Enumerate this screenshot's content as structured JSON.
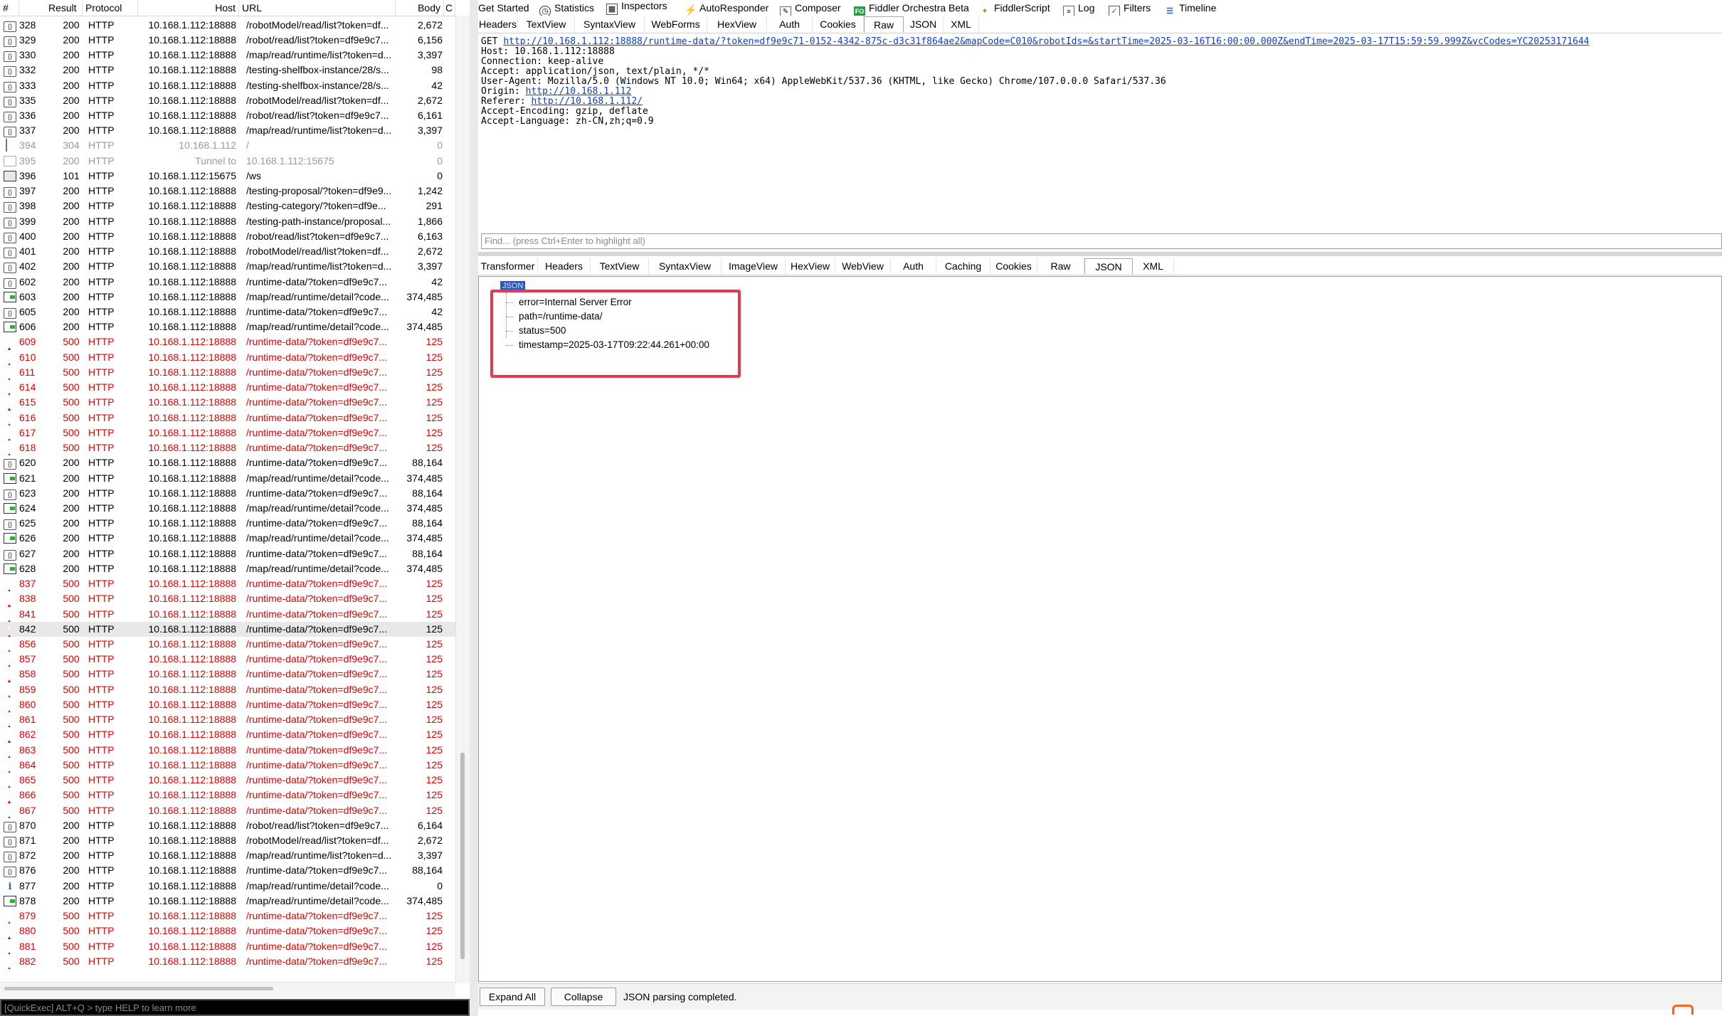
{
  "session_list": {
    "columns": [
      "#",
      "Result",
      "Protocol",
      "Host",
      "URL",
      "Body",
      "C"
    ],
    "rows": [
      {
        "icon": "doc",
        "num": "328",
        "result": "200",
        "protocol": "HTTP",
        "host": "10.168.1.112:18888",
        "url": "/robotModel/read/list?token=df...",
        "body": "2,672",
        "style": "normal"
      },
      {
        "icon": "doc",
        "num": "329",
        "result": "200",
        "protocol": "HTTP",
        "host": "10.168.1.112:18888",
        "url": "/robot/read/list?token=df9e9c7...",
        "body": "6,156",
        "style": "normal"
      },
      {
        "icon": "doc",
        "num": "330",
        "result": "200",
        "protocol": "HTTP",
        "host": "10.168.1.112:18888",
        "url": "/map/read/runtime/list?token=d...",
        "body": "3,397",
        "style": "normal"
      },
      {
        "icon": "doc",
        "num": "332",
        "result": "200",
        "protocol": "HTTP",
        "host": "10.168.1.112:18888",
        "url": "/testing-shelfbox-instance/28/s...",
        "body": "98",
        "style": "normal"
      },
      {
        "icon": "doc",
        "num": "333",
        "result": "200",
        "protocol": "HTTP",
        "host": "10.168.1.112:18888",
        "url": "/testing-shelfbox-instance/28/s...",
        "body": "42",
        "style": "normal"
      },
      {
        "icon": "doc",
        "num": "335",
        "result": "200",
        "protocol": "HTTP",
        "host": "10.168.1.112:18888",
        "url": "/robotModel/read/list?token=df...",
        "body": "2,672",
        "style": "normal"
      },
      {
        "icon": "doc",
        "num": "336",
        "result": "200",
        "protocol": "HTTP",
        "host": "10.168.1.112:18888",
        "url": "/robot/read/list?token=df9e9c7...",
        "body": "6,161",
        "style": "normal"
      },
      {
        "icon": "doc",
        "num": "337",
        "result": "200",
        "protocol": "HTTP",
        "host": "10.168.1.112:18888",
        "url": "/map/read/runtime/list?token=d...",
        "body": "3,397",
        "style": "normal"
      },
      {
        "icon": "diamond",
        "num": "394",
        "result": "304",
        "protocol": "HTTP",
        "host": "10.168.1.112",
        "url": "/",
        "body": "0",
        "style": "gray"
      },
      {
        "icon": "lock",
        "num": "395",
        "result": "200",
        "protocol": "HTTP",
        "host": "Tunnel to",
        "url": "10.168.1.112:15675",
        "body": "0",
        "style": "gray"
      },
      {
        "icon": "ws",
        "num": "396",
        "result": "101",
        "protocol": "HTTP",
        "host": "10.168.1.112:15675",
        "url": "/ws",
        "body": "0",
        "style": "normal"
      },
      {
        "icon": "doc",
        "num": "397",
        "result": "200",
        "protocol": "HTTP",
        "host": "10.168.1.112:18888",
        "url": "/testing-proposal/?token=df9e9...",
        "body": "1,242",
        "style": "normal"
      },
      {
        "icon": "doc",
        "num": "398",
        "result": "200",
        "protocol": "HTTP",
        "host": "10.168.1.112:18888",
        "url": "/testing-category/?token=df9e...",
        "body": "291",
        "style": "normal"
      },
      {
        "icon": "doc",
        "num": "399",
        "result": "200",
        "protocol": "HTTP",
        "host": "10.168.1.112:18888",
        "url": "/testing-path-instance/proposal...",
        "body": "1,866",
        "style": "normal"
      },
      {
        "icon": "doc",
        "num": "400",
        "result": "200",
        "protocol": "HTTP",
        "host": "10.168.1.112:18888",
        "url": "/robot/read/list?token=df9e9c7...",
        "body": "6,163",
        "style": "normal"
      },
      {
        "icon": "doc",
        "num": "401",
        "result": "200",
        "protocol": "HTTP",
        "host": "10.168.1.112:18888",
        "url": "/robotModel/read/list?token=df...",
        "body": "2,672",
        "style": "normal"
      },
      {
        "icon": "doc",
        "num": "402",
        "result": "200",
        "protocol": "HTTP",
        "host": "10.168.1.112:18888",
        "url": "/map/read/runtime/list?token=d...",
        "body": "3,397",
        "style": "normal"
      },
      {
        "icon": "doc",
        "num": "602",
        "result": "200",
        "protocol": "HTTP",
        "host": "10.168.1.112:18888",
        "url": "/runtime-data/?token=df9e9c7...",
        "body": "42",
        "style": "normal"
      },
      {
        "icon": "green",
        "num": "603",
        "result": "200",
        "protocol": "HTTP",
        "host": "10.168.1.112:18888",
        "url": "/map/read/runtime/detail?code...",
        "body": "374,485",
        "style": "normal"
      },
      {
        "icon": "doc",
        "num": "605",
        "result": "200",
        "protocol": "HTTP",
        "host": "10.168.1.112:18888",
        "url": "/runtime-data/?token=df9e9c7...",
        "body": "42",
        "style": "normal"
      },
      {
        "icon": "green",
        "num": "606",
        "result": "200",
        "protocol": "HTTP",
        "host": "10.168.1.112:18888",
        "url": "/map/read/runtime/detail?code...",
        "body": "374,485",
        "style": "normal"
      },
      {
        "icon": "warn",
        "num": "609",
        "result": "500",
        "protocol": "HTTP",
        "host": "10.168.1.112:18888",
        "url": "/runtime-data/?token=df9e9c7...",
        "body": "125",
        "style": "err"
      },
      {
        "icon": "warn",
        "num": "610",
        "result": "500",
        "protocol": "HTTP",
        "host": "10.168.1.112:18888",
        "url": "/runtime-data/?token=df9e9c7...",
        "body": "125",
        "style": "err"
      },
      {
        "icon": "warn",
        "num": "611",
        "result": "500",
        "protocol": "HTTP",
        "host": "10.168.1.112:18888",
        "url": "/runtime-data/?token=df9e9c7...",
        "body": "125",
        "style": "err"
      },
      {
        "icon": "warn",
        "num": "614",
        "result": "500",
        "protocol": "HTTP",
        "host": "10.168.1.112:18888",
        "url": "/runtime-data/?token=df9e9c7...",
        "body": "125",
        "style": "err"
      },
      {
        "icon": "warn",
        "num": "615",
        "result": "500",
        "protocol": "HTTP",
        "host": "10.168.1.112:18888",
        "url": "/runtime-data/?token=df9e9c7...",
        "body": "125",
        "style": "err"
      },
      {
        "icon": "warn",
        "num": "616",
        "result": "500",
        "protocol": "HTTP",
        "host": "10.168.1.112:18888",
        "url": "/runtime-data/?token=df9e9c7...",
        "body": "125",
        "style": "err"
      },
      {
        "icon": "warn",
        "num": "617",
        "result": "500",
        "protocol": "HTTP",
        "host": "10.168.1.112:18888",
        "url": "/runtime-data/?token=df9e9c7...",
        "body": "125",
        "style": "err"
      },
      {
        "icon": "warn",
        "num": "618",
        "result": "500",
        "protocol": "HTTP",
        "host": "10.168.1.112:18888",
        "url": "/runtime-data/?token=df9e9c7...",
        "body": "125",
        "style": "err"
      },
      {
        "icon": "doc",
        "num": "620",
        "result": "200",
        "protocol": "HTTP",
        "host": "10.168.1.112:18888",
        "url": "/runtime-data/?token=df9e9c7...",
        "body": "88,164",
        "style": "normal"
      },
      {
        "icon": "green",
        "num": "621",
        "result": "200",
        "protocol": "HTTP",
        "host": "10.168.1.112:18888",
        "url": "/map/read/runtime/detail?code...",
        "body": "374,485",
        "style": "normal"
      },
      {
        "icon": "doc",
        "num": "623",
        "result": "200",
        "protocol": "HTTP",
        "host": "10.168.1.112:18888",
        "url": "/runtime-data/?token=df9e9c7...",
        "body": "88,164",
        "style": "normal"
      },
      {
        "icon": "green",
        "num": "624",
        "result": "200",
        "protocol": "HTTP",
        "host": "10.168.1.112:18888",
        "url": "/map/read/runtime/detail?code...",
        "body": "374,485",
        "style": "normal"
      },
      {
        "icon": "doc",
        "num": "625",
        "result": "200",
        "protocol": "HTTP",
        "host": "10.168.1.112:18888",
        "url": "/runtime-data/?token=df9e9c7...",
        "body": "88,164",
        "style": "normal"
      },
      {
        "icon": "green",
        "num": "626",
        "result": "200",
        "protocol": "HTTP",
        "host": "10.168.1.112:18888",
        "url": "/map/read/runtime/detail?code...",
        "body": "374,485",
        "style": "normal"
      },
      {
        "icon": "doc",
        "num": "627",
        "result": "200",
        "protocol": "HTTP",
        "host": "10.168.1.112:18888",
        "url": "/runtime-data/?token=df9e9c7...",
        "body": "88,164",
        "style": "normal"
      },
      {
        "icon": "green",
        "num": "628",
        "result": "200",
        "protocol": "HTTP",
        "host": "10.168.1.112:18888",
        "url": "/map/read/runtime/detail?code...",
        "body": "374,485",
        "style": "normal"
      },
      {
        "icon": "warn",
        "num": "837",
        "result": "500",
        "protocol": "HTTP",
        "host": "10.168.1.112:18888",
        "url": "/runtime-data/?token=df9e9c7...",
        "body": "125",
        "style": "err"
      },
      {
        "icon": "warn",
        "num": "838",
        "result": "500",
        "protocol": "HTTP",
        "host": "10.168.1.112:18888",
        "url": "/runtime-data/?token=df9e9c7...",
        "body": "125",
        "style": "err"
      },
      {
        "icon": "warn",
        "num": "841",
        "result": "500",
        "protocol": "HTTP",
        "host": "10.168.1.112:18888",
        "url": "/runtime-data/?token=df9e9c7...",
        "body": "125",
        "style": "err"
      },
      {
        "icon": "warn",
        "num": "842",
        "result": "500",
        "protocol": "HTTP",
        "host": "10.168.1.112:18888",
        "url": "/runtime-data/?token=df9e9c7...",
        "body": "125",
        "style": "selected"
      },
      {
        "icon": "warn",
        "num": "856",
        "result": "500",
        "protocol": "HTTP",
        "host": "10.168.1.112:18888",
        "url": "/runtime-data/?token=df9e9c7...",
        "body": "125",
        "style": "err"
      },
      {
        "icon": "warn",
        "num": "857",
        "result": "500",
        "protocol": "HTTP",
        "host": "10.168.1.112:18888",
        "url": "/runtime-data/?token=df9e9c7...",
        "body": "125",
        "style": "err"
      },
      {
        "icon": "warn",
        "num": "858",
        "result": "500",
        "protocol": "HTTP",
        "host": "10.168.1.112:18888",
        "url": "/runtime-data/?token=df9e9c7...",
        "body": "125",
        "style": "err"
      },
      {
        "icon": "warn",
        "num": "859",
        "result": "500",
        "protocol": "HTTP",
        "host": "10.168.1.112:18888",
        "url": "/runtime-data/?token=df9e9c7...",
        "body": "125",
        "style": "err"
      },
      {
        "icon": "warn",
        "num": "860",
        "result": "500",
        "protocol": "HTTP",
        "host": "10.168.1.112:18888",
        "url": "/runtime-data/?token=df9e9c7...",
        "body": "125",
        "style": "err"
      },
      {
        "icon": "warn",
        "num": "861",
        "result": "500",
        "protocol": "HTTP",
        "host": "10.168.1.112:18888",
        "url": "/runtime-data/?token=df9e9c7...",
        "body": "125",
        "style": "err"
      },
      {
        "icon": "warn",
        "num": "862",
        "result": "500",
        "protocol": "HTTP",
        "host": "10.168.1.112:18888",
        "url": "/runtime-data/?token=df9e9c7...",
        "body": "125",
        "style": "err"
      },
      {
        "icon": "warn",
        "num": "863",
        "result": "500",
        "protocol": "HTTP",
        "host": "10.168.1.112:18888",
        "url": "/runtime-data/?token=df9e9c7...",
        "body": "125",
        "style": "err"
      },
      {
        "icon": "warn",
        "num": "864",
        "result": "500",
        "protocol": "HTTP",
        "host": "10.168.1.112:18888",
        "url": "/runtime-data/?token=df9e9c7...",
        "body": "125",
        "style": "err"
      },
      {
        "icon": "warn",
        "num": "865",
        "result": "500",
        "protocol": "HTTP",
        "host": "10.168.1.112:18888",
        "url": "/runtime-data/?token=df9e9c7...",
        "body": "125",
        "style": "err"
      },
      {
        "icon": "warn",
        "num": "866",
        "result": "500",
        "protocol": "HTTP",
        "host": "10.168.1.112:18888",
        "url": "/runtime-data/?token=df9e9c7...",
        "body": "125",
        "style": "err"
      },
      {
        "icon": "warn",
        "num": "867",
        "result": "500",
        "protocol": "HTTP",
        "host": "10.168.1.112:18888",
        "url": "/runtime-data/?token=df9e9c7...",
        "body": "125",
        "style": "err"
      },
      {
        "icon": "doc",
        "num": "870",
        "result": "200",
        "protocol": "HTTP",
        "host": "10.168.1.112:18888",
        "url": "/robot/read/list?token=df9e9c7...",
        "body": "6,164",
        "style": "normal"
      },
      {
        "icon": "doc",
        "num": "871",
        "result": "200",
        "protocol": "HTTP",
        "host": "10.168.1.112:18888",
        "url": "/robotModel/read/list?token=df...",
        "body": "2,672",
        "style": "normal"
      },
      {
        "icon": "doc",
        "num": "872",
        "result": "200",
        "protocol": "HTTP",
        "host": "10.168.1.112:18888",
        "url": "/map/read/runtime/list?token=d...",
        "body": "3,397",
        "style": "normal"
      },
      {
        "icon": "doc",
        "num": "876",
        "result": "200",
        "protocol": "HTTP",
        "host": "10.168.1.112:18888",
        "url": "/runtime-data/?token=df9e9c7...",
        "body": "88,164",
        "style": "normal"
      },
      {
        "icon": "info",
        "num": "877",
        "result": "200",
        "protocol": "HTTP",
        "host": "10.168.1.112:18888",
        "url": "/map/read/runtime/detail?code...",
        "body": "0",
        "style": "normal"
      },
      {
        "icon": "green",
        "num": "878",
        "result": "200",
        "protocol": "HTTP",
        "host": "10.168.1.112:18888",
        "url": "/map/read/runtime/detail?code...",
        "body": "374,485",
        "style": "normal"
      },
      {
        "icon": "warn",
        "num": "879",
        "result": "500",
        "protocol": "HTTP",
        "host": "10.168.1.112:18888",
        "url": "/runtime-data/?token=df9e9c7...",
        "body": "125",
        "style": "err"
      },
      {
        "icon": "warn",
        "num": "880",
        "result": "500",
        "protocol": "HTTP",
        "host": "10.168.1.112:18888",
        "url": "/runtime-data/?token=df9e9c7...",
        "body": "125",
        "style": "err"
      },
      {
        "icon": "warn",
        "num": "881",
        "result": "500",
        "protocol": "HTTP",
        "host": "10.168.1.112:18888",
        "url": "/runtime-data/?token=df9e9c7...",
        "body": "125",
        "style": "err"
      },
      {
        "icon": "warn",
        "num": "882",
        "result": "500",
        "protocol": "HTTP",
        "host": "10.168.1.112:18888",
        "url": "/runtime-data/?token=df9e9c7...",
        "body": "125",
        "style": "err"
      }
    ]
  },
  "quickexec": {
    "text": "[QuickExec] ALT+Q > type HELP to learn more"
  },
  "toolbar": {
    "get_started": "Get Started",
    "statistics": "Statistics",
    "inspectors": "Inspectors",
    "autoresponder": "AutoResponder",
    "composer": "Composer",
    "orchestra": "Fiddler Orchestra Beta",
    "orchestra_badge": "FO",
    "fiddlerscript": "FiddlerScript",
    "log": "Log",
    "filters": "Filters",
    "timeline": "Timeline"
  },
  "request_tabs": [
    "Headers",
    "TextView",
    "SyntaxView",
    "WebForms",
    "HexView",
    "Auth",
    "Cookies",
    "Raw",
    "JSON",
    "XML"
  ],
  "request_raw": {
    "method": "GET ",
    "url": "http://10.168.1.112:18888/runtime-data/?token=df9e9c71-0152-4342-875c-d3c31f864ae2&mapCode=C010&robotIds=&startTime=2025-03-16T16:00:00.000Z&endTime=2025-03-17T15:59:59.999Z&vcCodes=YC20253171644",
    "line_host": "Host: 10.168.1.112:18888",
    "line_connection": "Connection: keep-alive",
    "line_accept": "Accept: application/json, text/plain, */*",
    "line_useragent": "User-Agent: Mozilla/5.0 (Windows NT 10.0; Win64; x64) AppleWebKit/537.36 (KHTML, like Gecko) Chrome/107.0.0.0 Safari/537.36",
    "origin_label": "Origin: ",
    "origin_url": "http://10.168.1.112",
    "referer_label": "Referer: ",
    "referer_url": "http://10.168.1.112/",
    "line_encoding": "Accept-Encoding: gzip, deflate",
    "line_language": "Accept-Language: zh-CN,zh;q=0.9"
  },
  "find": {
    "placeholder": "Find... (press Ctrl+Enter to highlight all)"
  },
  "response_tabs": [
    "Transformer",
    "Headers",
    "TextView",
    "SyntaxView",
    "ImageView",
    "HexView",
    "WebView",
    "Auth",
    "Caching",
    "Cookies",
    "Raw",
    "JSON",
    "XML"
  ],
  "json_tree": {
    "root": "JSON",
    "items": [
      "error=Internal Server Error",
      "path=/runtime-data/",
      "status=500",
      "timestamp=2025-03-17T09:22:44.261+00:00"
    ]
  },
  "bottom": {
    "expand_all": "Expand All",
    "collapse": "Collapse",
    "status": "JSON parsing completed."
  },
  "colors": {
    "error_red": "#e00000",
    "highlight_box": "#e8384f",
    "link_blue": "#0b3fd6"
  }
}
